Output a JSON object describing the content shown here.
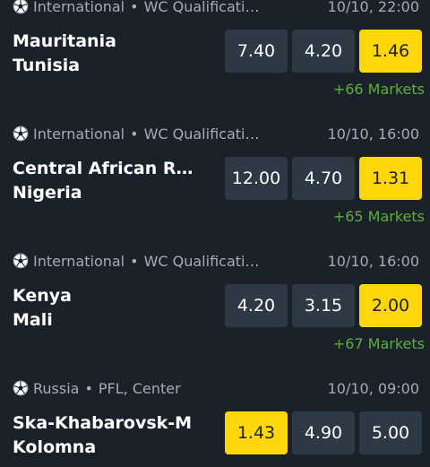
{
  "matches": [
    {
      "league": "International",
      "competition": "WC Qualificati",
      "competition_suffix": "…",
      "datetime": "10/10, 22:00",
      "home": "Mauritania",
      "away": "Tunisia",
      "odds": [
        "7.40",
        "4.20",
        "1.46"
      ],
      "selected": 2,
      "markets": "+66 Markets"
    },
    {
      "league": "International",
      "competition": "WC Qualificati",
      "competition_suffix": "…",
      "datetime": "10/10, 16:00",
      "home": "Central African R…",
      "away": "Nigeria",
      "odds": [
        "12.00",
        "4.70",
        "1.31"
      ],
      "selected": 2,
      "markets": "+65 Markets"
    },
    {
      "league": "International",
      "competition": "WC Qualificati",
      "competition_suffix": "…",
      "datetime": "10/10, 16:00",
      "home": "Kenya",
      "away": "Mali",
      "odds": [
        "4.20",
        "3.15",
        "2.00"
      ],
      "selected": 2,
      "markets": "+67 Markets"
    },
    {
      "league": "Russia",
      "competition": "PFL, Center",
      "competition_suffix": "",
      "datetime": "10/10, 09:00",
      "home": "Ska-Khabarovsk-M",
      "away": "Kolomna",
      "odds": [
        "1.43",
        "4.90",
        "5.00"
      ],
      "selected": 0,
      "markets": ""
    }
  ],
  "colors": {
    "background": "#1a2128",
    "odd_button": "#2d3944",
    "odd_selected": "#ffd60a",
    "markets_link": "#5fae3e",
    "meta_text": "#a3adb8"
  },
  "icons": {
    "sport": "soccer-ball-icon"
  }
}
